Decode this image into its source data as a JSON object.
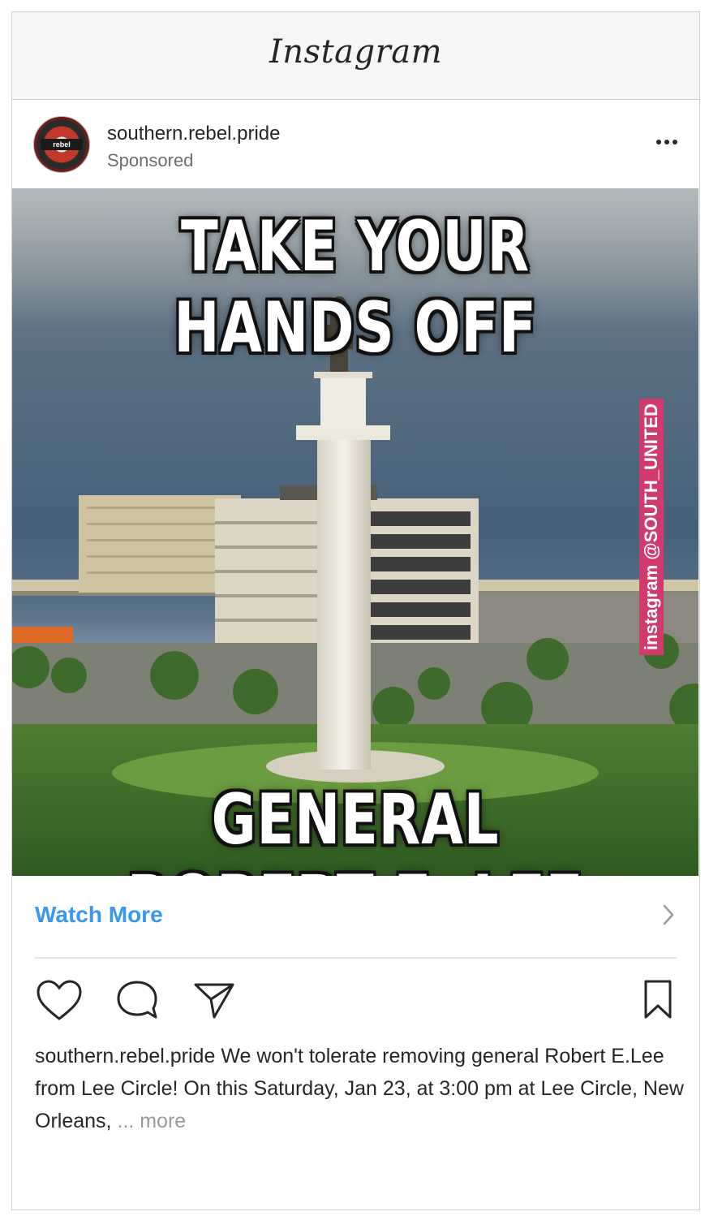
{
  "app": {
    "title": "Instagram"
  },
  "post": {
    "username": "southern.rebel.pride",
    "sponsored_label": "Sponsored",
    "avatar_text": "rebel",
    "image": {
      "top_text": "TAKE YOUR HANDS OFF",
      "bottom_text": "GENERAL ROBERT E. LEE",
      "watermark": "instagram @SOUTH_UNITED"
    },
    "cta": {
      "label": "Watch More",
      "chevron_icon": "chevron-right-icon"
    },
    "actions": {
      "like_icon": "heart-icon",
      "comment_icon": "comment-icon",
      "share_icon": "send-icon",
      "save_icon": "bookmark-icon"
    },
    "caption": {
      "username": "southern.rebel.pride",
      "text": " We won't tolerate removing general Robert E.Lee from Lee Circle! On this Saturday, Jan 23, at 3:00 pm at Lee Circle, New Orleans, ",
      "ellipsis": "...",
      "more_label": " more"
    }
  },
  "colors": {
    "link_blue": "#3897f0",
    "text_dark": "#262626",
    "text_muted": "#6d6d6d",
    "header_bg": "#f6f6f6"
  }
}
